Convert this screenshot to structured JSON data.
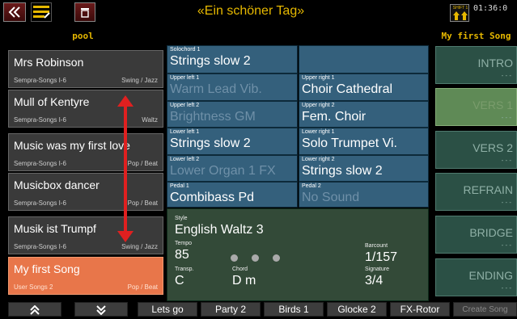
{
  "header": {
    "title": "«Ein schöner Tag»",
    "clock": "01:36:0",
    "shift_label": "SHIFT 1",
    "pool_label": "pool",
    "current_song": "My first Song"
  },
  "songs": [
    {
      "name": "Mrs Robinson",
      "library": "Sempra-Songs I-6",
      "style": "Swing / Jazz",
      "selected": false
    },
    {
      "name": "Mull of Kentyre",
      "library": "Sempra-Songs I-6",
      "style": "Waltz",
      "selected": false
    },
    {
      "name": "Music was my first love",
      "library": "Sempra-Songs I-6",
      "style": "Pop / Beat",
      "selected": false
    },
    {
      "name": "Musicbox dancer",
      "library": "Sempra-Songs I-6",
      "style": "Pop / Beat",
      "selected": false
    },
    {
      "name": "Musik ist Trumpf",
      "library": "Sempra-Songs I-6",
      "style": "Swing / Jazz",
      "selected": false
    },
    {
      "name": "My first Song",
      "library": "User Songs 2",
      "style": "Pop / Beat",
      "selected": true
    }
  ],
  "voices": {
    "solochord1": {
      "label": "Solochord 1",
      "value": "Strings slow 2"
    },
    "upper_left1": {
      "label": "Upper left 1",
      "value": "Warm Lead Vib."
    },
    "upper_right1": {
      "label": "Upper right 1",
      "value": "Choir Cathedral"
    },
    "upper_left2": {
      "label": "Upper left 2",
      "value": "Brightness  GM"
    },
    "upper_right2": {
      "label": "Upper right 2",
      "value": "Fem. Choir"
    },
    "lower_left1": {
      "label": "Lower left 1",
      "value": "Strings slow 2"
    },
    "lower_right1": {
      "label": "Lower right 1",
      "value": "Solo Trumpet Vi."
    },
    "lower_left2": {
      "label": "Lower left 2",
      "value": "Lower Organ 1 FX"
    },
    "lower_right2": {
      "label": "Lower right 2",
      "value": "Strings slow 2"
    },
    "pedal1": {
      "label": "Pedal 1",
      "value": "Combibass   Pd"
    },
    "pedal2": {
      "label": "Pedal 2",
      "value": "No Sound"
    }
  },
  "style": {
    "style_label": "Style",
    "style_value": "English Waltz 3",
    "tempo_label": "Tempo",
    "tempo_value": "85",
    "barcount_label": "Barcount",
    "barcount_value": "1/157",
    "transp_label": "Transp.",
    "transp_value": "C",
    "chord_label": "Chord",
    "chord_value": "D  m",
    "signature_label": "Signature",
    "signature_value": "3/4"
  },
  "parts": [
    {
      "label": "INTRO",
      "sub": "- - -",
      "active": false
    },
    {
      "label": "VERS 1",
      "sub": "- - -",
      "active": true
    },
    {
      "label": "VERS 2",
      "sub": "- - -",
      "active": false
    },
    {
      "label": "REFRAIN",
      "sub": "- - -",
      "active": false
    },
    {
      "label": "BRIDGE",
      "sub": "- - -",
      "active": false
    },
    {
      "label": "ENDING",
      "sub": "- - -",
      "active": false
    }
  ],
  "bottom": {
    "up_icon": "double-chevron-up",
    "down_icon": "double-chevron-down",
    "buttons": [
      "Lets go",
      "Party 2",
      "Birds 1",
      "Glocke 2",
      "FX-Rotor",
      "Create Song"
    ]
  },
  "colors": {
    "accent_yellow": "#e6b800",
    "selected_song": "#e8764a",
    "voice_cell": "#34607c",
    "style_panel": "#334a38",
    "part_active": "#5f8a56",
    "arrow_red": "#e02020"
  }
}
